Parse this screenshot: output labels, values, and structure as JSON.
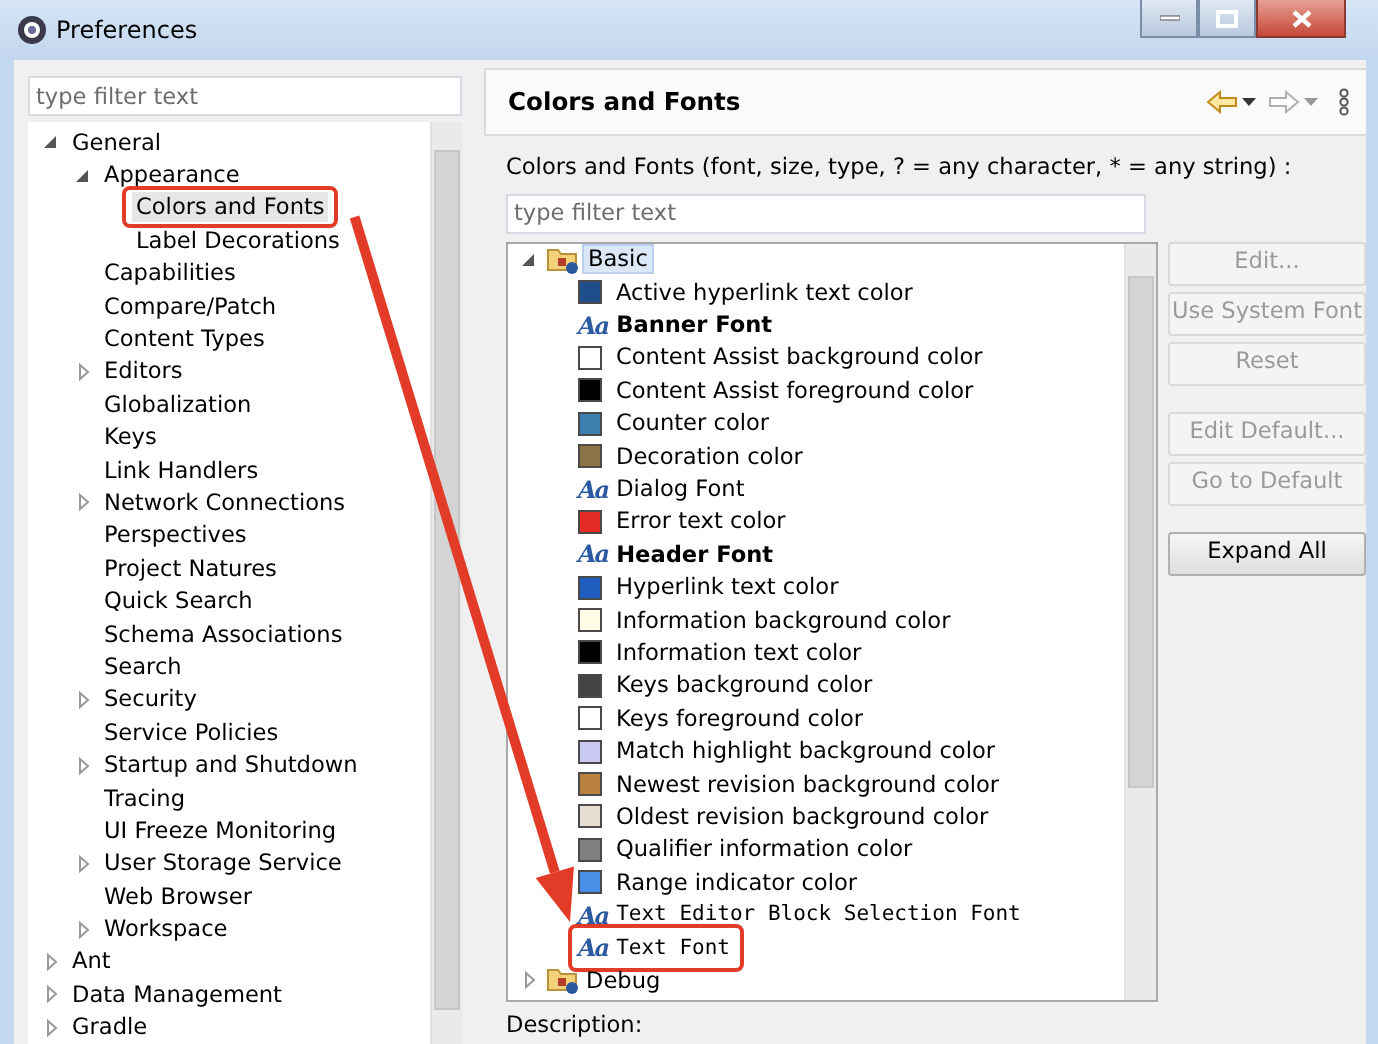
{
  "window": {
    "title": "Preferences"
  },
  "sidebar": {
    "filter": {
      "placeholder": "type filter text"
    },
    "tree": [
      {
        "label": "General",
        "expanded": true,
        "selected": false,
        "annotated": false,
        "children": [
          {
            "label": "Appearance",
            "expanded": true,
            "selected": false,
            "annotated": false,
            "children": [
              {
                "label": "Colors and Fonts",
                "selected": true,
                "annotated": true
              },
              {
                "label": "Label Decorations",
                "selected": false,
                "annotated": false
              }
            ]
          },
          {
            "label": "Capabilities",
            "selected": false,
            "annotated": false
          },
          {
            "label": "Compare/Patch",
            "selected": false,
            "annotated": false
          },
          {
            "label": "Content Types",
            "selected": false,
            "annotated": false
          },
          {
            "label": "Editors",
            "expanded": false,
            "selected": false,
            "annotated": false
          },
          {
            "label": "Globalization",
            "selected": false,
            "annotated": false
          },
          {
            "label": "Keys",
            "selected": false,
            "annotated": false
          },
          {
            "label": "Link Handlers",
            "selected": false,
            "annotated": false
          },
          {
            "label": "Network Connections",
            "expanded": false,
            "selected": false,
            "annotated": false
          },
          {
            "label": "Perspectives",
            "selected": false,
            "annotated": false
          },
          {
            "label": "Project Natures",
            "selected": false,
            "annotated": false
          },
          {
            "label": "Quick Search",
            "selected": false,
            "annotated": false
          },
          {
            "label": "Schema Associations",
            "selected": false,
            "annotated": false
          },
          {
            "label": "Search",
            "selected": false,
            "annotated": false
          },
          {
            "label": "Security",
            "expanded": false,
            "selected": false,
            "annotated": false
          },
          {
            "label": "Service Policies",
            "selected": false,
            "annotated": false
          },
          {
            "label": "Startup and Shutdown",
            "expanded": false,
            "selected": false,
            "annotated": false
          },
          {
            "label": "Tracing",
            "selected": false,
            "annotated": false
          },
          {
            "label": "UI Freeze Monitoring",
            "selected": false,
            "annotated": false
          },
          {
            "label": "User Storage Service",
            "expanded": false,
            "selected": false,
            "annotated": false
          },
          {
            "label": "Web Browser",
            "selected": false,
            "annotated": false
          },
          {
            "label": "Workspace",
            "expanded": false,
            "selected": false,
            "annotated": false
          }
        ]
      },
      {
        "label": "Ant",
        "expanded": false,
        "selected": false,
        "annotated": false
      },
      {
        "label": "Data Management",
        "expanded": false,
        "selected": false,
        "annotated": false
      },
      {
        "label": "Gradle",
        "expanded": false,
        "selected": false,
        "annotated": false
      }
    ]
  },
  "page": {
    "title": "Colors and Fonts",
    "filter_label": "Colors and Fonts (font, size, type, ? = any character, * = any string) :",
    "filter": {
      "placeholder": "type filter text"
    },
    "tree": [
      {
        "kind": "category",
        "label": "Basic",
        "expanded": true,
        "selected": true,
        "annotated": false,
        "children": [
          {
            "kind": "color",
            "label": "Active hyperlink text color",
            "color": "#1f4e8c",
            "selected": false,
            "annotated": false
          },
          {
            "kind": "bold_font",
            "icon": "Aa",
            "label": "Banner Font",
            "selected": false,
            "annotated": false
          },
          {
            "kind": "color",
            "label": "Content Assist background color",
            "color": "#ffffff",
            "selected": false,
            "annotated": false
          },
          {
            "kind": "color",
            "label": "Content Assist foreground color",
            "color": "#000000",
            "selected": false,
            "annotated": false
          },
          {
            "kind": "color",
            "label": "Counter color",
            "color": "#3b80ae",
            "selected": false,
            "annotated": false
          },
          {
            "kind": "color",
            "label": "Decoration color",
            "color": "#8b7346",
            "selected": false,
            "annotated": false
          },
          {
            "kind": "font",
            "icon": "Aa",
            "label": "Dialog Font",
            "selected": false,
            "annotated": false
          },
          {
            "kind": "color",
            "label": "Error text color",
            "color": "#e52b25",
            "selected": false,
            "annotated": false
          },
          {
            "kind": "bold_font",
            "icon": "Aa",
            "label": "Header Font",
            "selected": false,
            "annotated": false
          },
          {
            "kind": "color",
            "label": "Hyperlink text color",
            "color": "#1e5dbd",
            "selected": false,
            "annotated": false
          },
          {
            "kind": "color",
            "label": "Information background color",
            "color": "#fffde5",
            "selected": false,
            "annotated": false
          },
          {
            "kind": "color",
            "label": "Information text color",
            "color": "#000000",
            "selected": false,
            "annotated": false
          },
          {
            "kind": "color",
            "label": "Keys background color",
            "color": "#444444",
            "selected": false,
            "annotated": false
          },
          {
            "kind": "color",
            "label": "Keys foreground color",
            "color": "#ffffff",
            "selected": false,
            "annotated": false
          },
          {
            "kind": "color",
            "label": "Match highlight background color",
            "color": "#c8c8f0",
            "selected": false,
            "annotated": false
          },
          {
            "kind": "color",
            "label": "Newest revision background color",
            "color": "#b8823e",
            "selected": false,
            "annotated": false
          },
          {
            "kind": "color",
            "label": "Oldest revision background color",
            "color": "#e8dfd2",
            "selected": false,
            "annotated": false
          },
          {
            "kind": "color",
            "label": "Qualifier information color",
            "color": "#808080",
            "selected": false,
            "annotated": false
          },
          {
            "kind": "color",
            "label": "Range indicator color",
            "color": "#4a90e8",
            "selected": false,
            "annotated": false
          },
          {
            "kind": "mono_font",
            "icon": "Aa",
            "label": "Text Editor Block Selection Font",
            "selected": false,
            "annotated": false
          },
          {
            "kind": "mono_font",
            "icon": "Aa",
            "label": "Text Font",
            "selected": false,
            "annotated": true
          }
        ]
      },
      {
        "kind": "category",
        "label": "Debug",
        "expanded": false,
        "selected": false,
        "annotated": false
      }
    ],
    "button_groups": [
      [
        {
          "label": "Edit...",
          "disabled": true
        },
        {
          "label": "Use System Font",
          "disabled": true
        },
        {
          "label": "Reset",
          "disabled": true
        }
      ],
      [
        {
          "label": "Edit Default...",
          "disabled": true
        },
        {
          "label": "Go to Default",
          "disabled": true
        }
      ],
      [
        {
          "label": "Expand All",
          "disabled": false
        }
      ]
    ],
    "description_label": "Description:"
  }
}
